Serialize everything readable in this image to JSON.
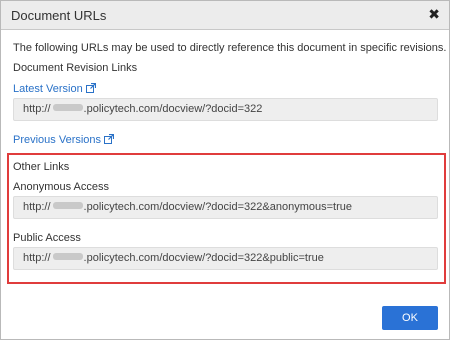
{
  "dialog": {
    "title": "Document URLs",
    "close_label": "✖"
  },
  "intro_text": "The following URLs may be used to directly reference this document in specific revisions.",
  "revision_links": {
    "heading": "Document Revision Links",
    "latest_version": {
      "label": "Latest Version",
      "url_prefix": "http://",
      "url_suffix": ".policytech.com/docview/?docid=322"
    },
    "previous_versions_label": "Previous Versions"
  },
  "other_links": {
    "heading": "Other Links",
    "anonymous": {
      "label": "Anonymous Access",
      "url_prefix": "http://",
      "url_suffix": ".policytech.com/docview/?docid=322&anonymous=true"
    },
    "public": {
      "label": "Public Access",
      "url_prefix": "http://",
      "url_suffix": ".policytech.com/docview/?docid=322&public=true"
    }
  },
  "buttons": {
    "ok_label": "OK"
  },
  "colors": {
    "link": "#2a72c8",
    "highlight_border": "#e03c3c",
    "ok_button": "#2a72d6"
  }
}
